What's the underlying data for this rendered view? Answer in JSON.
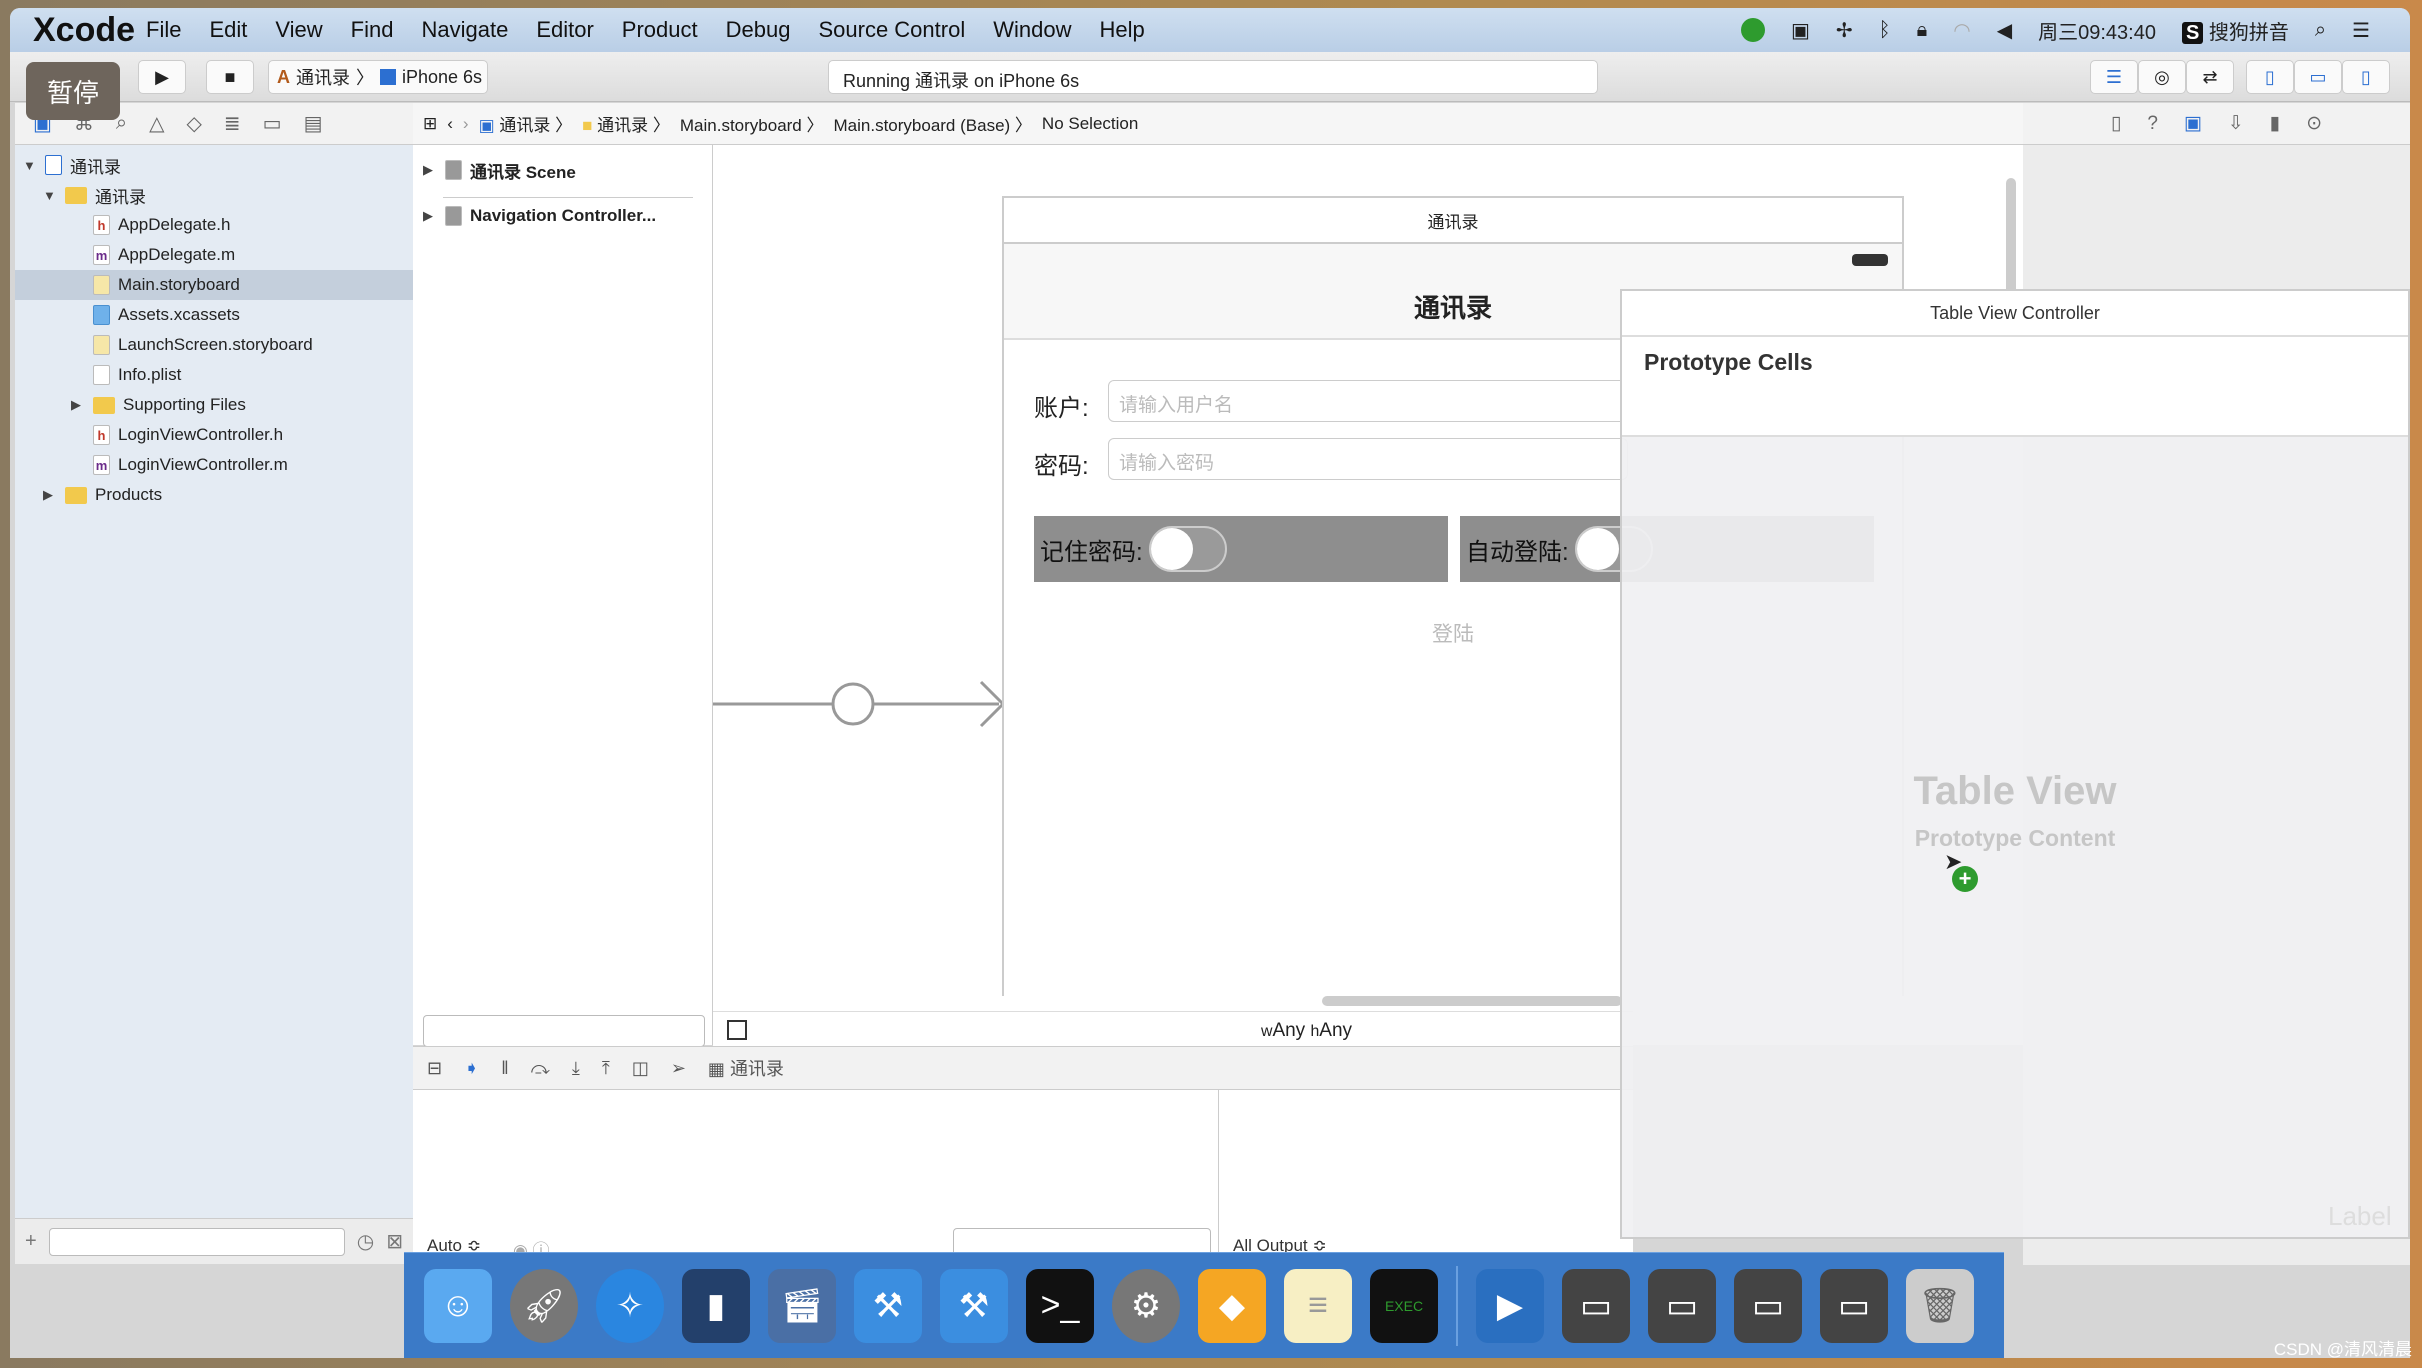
{
  "menubar": {
    "app": "Xcode",
    "items": [
      "File",
      "Edit",
      "View",
      "Find",
      "Navigate",
      "Editor",
      "Product",
      "Debug",
      "Source Control",
      "Window",
      "Help"
    ],
    "clock": "周三09:43:40",
    "input_method": "搜狗拼音"
  },
  "toolbar": {
    "scheme": "通讯录",
    "device": "iPhone 6s",
    "activity": "Running 通讯录 on iPhone 6s",
    "pause_overlay": "暂停"
  },
  "jumpbar": [
    "通讯录",
    "通讯录",
    "Main.storyboard",
    "Main.storyboard (Base)",
    "No Selection"
  ],
  "navigator": {
    "items": [
      {
        "label": "通讯录",
        "type": "project",
        "expanded": true
      },
      {
        "label": "通讯录",
        "type": "folder",
        "expanded": true
      },
      {
        "label": "AppDelegate.h",
        "type": "h"
      },
      {
        "label": "AppDelegate.m",
        "type": "m"
      },
      {
        "label": "Main.storyboard",
        "type": "storyboard",
        "selected": true
      },
      {
        "label": "Assets.xcassets",
        "type": "assets"
      },
      {
        "label": "LaunchScreen.storyboard",
        "type": "storyboard"
      },
      {
        "label": "Info.plist",
        "type": "plist"
      },
      {
        "label": "Supporting Files",
        "type": "folder",
        "expanded": false
      },
      {
        "label": "LoginViewController.h",
        "type": "h"
      },
      {
        "label": "LoginViewController.m",
        "type": "m"
      },
      {
        "label": "Products",
        "type": "folder",
        "expanded": false
      }
    ]
  },
  "outline": {
    "items": [
      "通讯录 Scene",
      "Navigation Controller..."
    ]
  },
  "scene": {
    "title": "通讯录",
    "nav_title": "通讯录",
    "account_label": "账户:",
    "account_placeholder": "请输入用户名",
    "password_label": "密码:",
    "password_placeholder": "请输入密码",
    "remember_label": "记住密码:",
    "autologin_label": "自动登陆:",
    "login_button": "登陆",
    "remember_on": false,
    "autologin_on": false
  },
  "sizeclass": {
    "w": "Any",
    "h": "Any",
    "w_prefix": "w",
    "h_prefix": "h"
  },
  "debugbar": {
    "target": "通讯录"
  },
  "debug": {
    "auto": "Auto ≎",
    "output": "All Output ≎"
  },
  "overlay": {
    "title": "Table View Controller",
    "section": "Prototype Cells",
    "placeholder_title": "Table View",
    "placeholder_sub": "Prototype Content",
    "library_label": "Label"
  },
  "watermark": "CSDN @清风清晨",
  "colors": {
    "menubar": "#c4d6ea",
    "selection": "#c4cfdc",
    "dock": "#3b7ac7",
    "switch_bg": "#8e8e8e",
    "add_badge": "#2e9b2e"
  }
}
